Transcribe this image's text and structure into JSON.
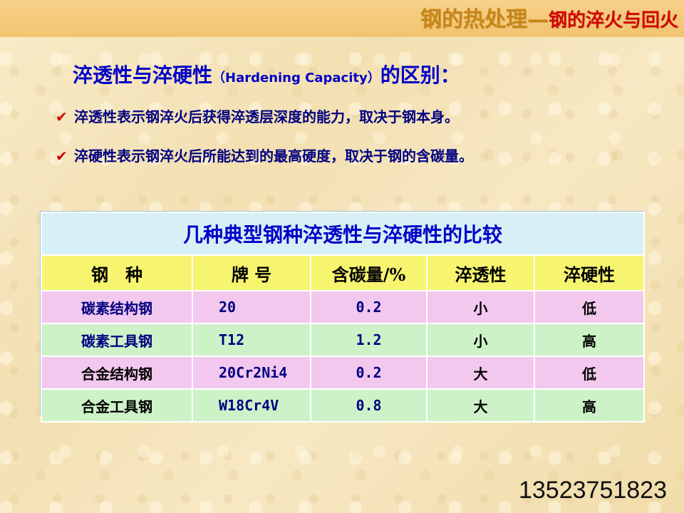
{
  "header": {
    "title_main": "钢的热处理",
    "dash": "—",
    "title_sub": "钢的淬火与回火"
  },
  "subtitle": {
    "prefix": "淬透性与淬硬性",
    "latin": "（Hardening Capacity）",
    "suffix": "的区别："
  },
  "bullets": [
    {
      "icon": "check-icon",
      "text": "淬透性表示钢淬火后获得淬透层深度的能力，取决于钢本身。"
    },
    {
      "icon": "check-icon",
      "text": "淬硬性表示钢淬火后所能达到的最高硬度，取决于钢的含碳量。"
    }
  ],
  "table": {
    "caption": "几种典型钢种淬透性与淬硬性的比较",
    "headers": [
      "钢　种",
      "牌 号",
      "含碳量/%",
      "淬透性",
      "淬硬性"
    ],
    "rows": [
      {
        "type": "碳素结构钢",
        "grade": "20",
        "carbon": "0.2",
        "hardenability": "小",
        "hardening_capacity": "低"
      },
      {
        "type": "碳素工具钢",
        "grade": "T12",
        "carbon": "1.2",
        "hardenability": "小",
        "hardening_capacity": "高"
      },
      {
        "type": "合金结构钢",
        "grade": "20Cr2Ni4",
        "carbon": "0.2",
        "hardenability": "大",
        "hardening_capacity": "低"
      },
      {
        "type": "合金工具钢",
        "grade": "W18Cr4V",
        "carbon": "0.8",
        "hardenability": "大",
        "hardening_capacity": "高"
      }
    ]
  },
  "footer": {
    "phone": "13523751823"
  },
  "colors": {
    "header_band": "#f1c46f",
    "header_main": "#c88617",
    "header_sub": "#d40000",
    "subtitle": "#0000c8",
    "bullet_text": "#000080",
    "check": "#cc0000",
    "caption_bg": "#d7f0f5",
    "header_row_bg": "#f7f46f",
    "pink_row_bg": "#f3c8ef",
    "green_row_bg": "#cdf2c8"
  }
}
